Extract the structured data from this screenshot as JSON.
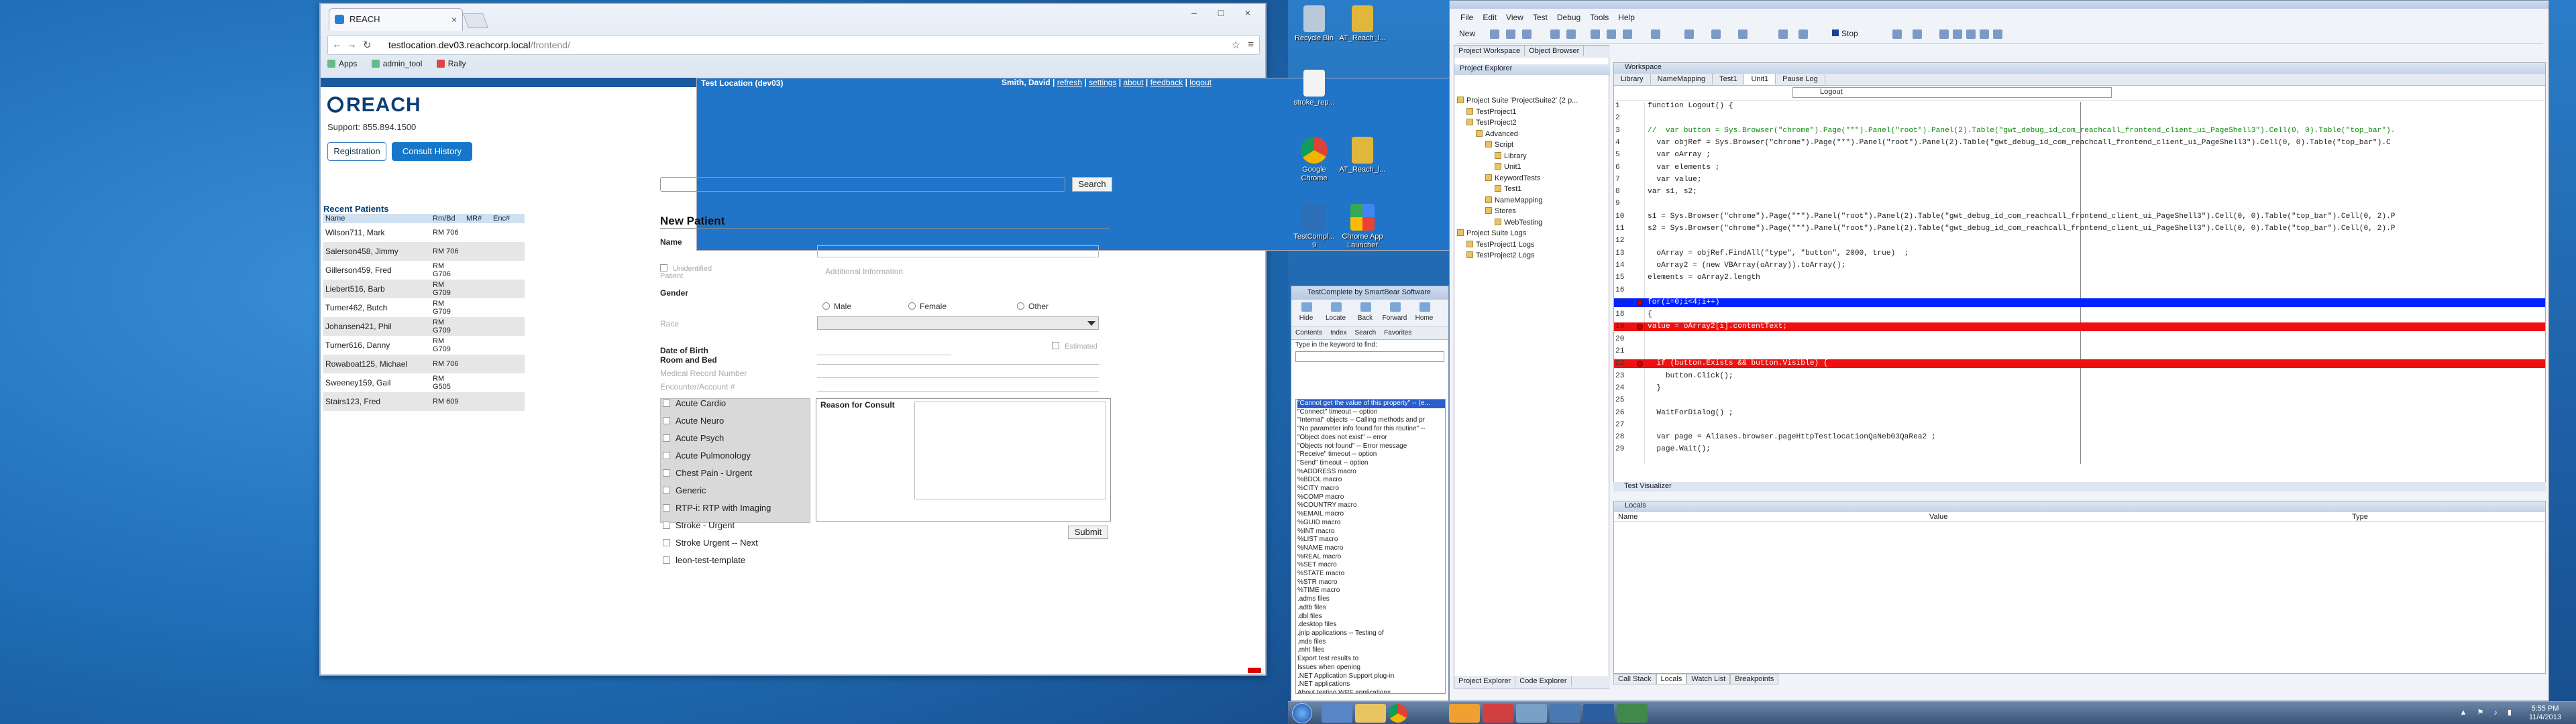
{
  "browser": {
    "tab_title": "REACH",
    "url_domain": "testlocation.dev03.reachcorp.local",
    "url_path": "/frontend/",
    "bookmarks": [
      "Apps",
      "admin_tool",
      "Rally"
    ]
  },
  "app": {
    "location_badge": "Test Location (dev03)",
    "user_name": "Smith, David",
    "nav_links": [
      "refresh",
      "settings",
      "about",
      "feedback",
      "logout"
    ],
    "logo_text": "REACH",
    "support": "Support: 855.894.1500",
    "btn_registration": "Registration",
    "btn_consult_history": "Consult History",
    "search_button": "Search",
    "recent_title": "Recent Patients",
    "recent_headers": [
      "Name",
      "Rm/Bd",
      "MR#",
      "Enc#"
    ],
    "recent_patients": [
      {
        "name": "Wilson711, Mark",
        "rb": "RM 706"
      },
      {
        "name": "Salerson458, Jimmy",
        "rb": "RM 706"
      },
      {
        "name": "Gillerson459, Fred",
        "rb": "RM G706"
      },
      {
        "name": "Liebert516, Barb",
        "rb": "RM G709"
      },
      {
        "name": "Turner462, Butch",
        "rb": "RM G709"
      },
      {
        "name": "Johansen421, Phil",
        "rb": "RM G709"
      },
      {
        "name": "Turner616, Danny",
        "rb": "RM G709"
      },
      {
        "name": "Rowaboat125, Michael",
        "rb": "RM 706"
      },
      {
        "name": "Sweeney159, Gail",
        "rb": "RM G505"
      },
      {
        "name": "Stairs123, Fred",
        "rb": "RM 609"
      }
    ],
    "new_patient_title": "New Patient",
    "name_label": "Name",
    "unidentified_label": "Unidentified Patient",
    "additional_info": "Additional Information",
    "gender_label": "Gender",
    "gender_options": [
      "Male",
      "Female",
      "Other"
    ],
    "race_label": "Race",
    "dob_label": "Date of Birth",
    "estimated_label": "Estimated",
    "room_label": "Room and Bed",
    "mrn_label": "Medical Record Number",
    "enc_label": "Encounter/Account #",
    "reason_label": "Reason for Consult",
    "submit_label": "Submit",
    "consult_types": [
      "Acute Cardio",
      "Acute Neuro",
      "Acute Psych",
      "Acute Pulmonology",
      "Chest Pain - Urgent",
      "Generic",
      "RTP-i: RTP with Imaging",
      "Stroke - Urgent",
      "Stroke Urgent -- Next",
      "leon-test-template"
    ]
  },
  "desktop_icons": [
    {
      "label": "Recycle Bin",
      "color": "#b9c9d9"
    },
    {
      "label": "AT_Reach_l...",
      "color": "#e0b73a"
    },
    {
      "label": "stroke_rep...",
      "color": "#f3f3f3"
    },
    {
      "label": "Google Chrome",
      "color": "#3a9b48"
    },
    {
      "label": "AT_Reach_l...",
      "color": "#e0b73a"
    },
    {
      "label": "TestCompl... 9",
      "color": "#2a6fb8"
    },
    {
      "label": "Chrome App Launcher",
      "color": "#4a90e2"
    }
  ],
  "help_window": {
    "title": "TestComplete by SmartBear Software",
    "tools": [
      "Hide",
      "Locate",
      "Back",
      "Forward",
      "Home"
    ],
    "tabs": [
      "Contents",
      "Index",
      "Search",
      "Favorites"
    ],
    "keyword_prompt": "Type in the keyword to find:",
    "selected": "\"Cannot get the value of this property\" -- (e...",
    "items": [
      "\"Connect\" timeout -- option",
      "\"Internal\" objects -- Calling methods and pr",
      "\"No parameter info found for this routine\" --",
      "\"Object does not exist\" -- error",
      "\"Objects not found\" -- Error message",
      "\"Receive\" timeout -- option",
      "\"Send\" timeout -- option",
      "%ADDRESS macro",
      "%BDOL macro",
      "%CITY macro",
      "%COMP macro",
      "%COUNTRY macro",
      "%EMAIL macro",
      "%GUID macro",
      "%INT macro",
      "%LIST macro",
      "%NAME macro",
      "%REAL macro",
      "%SET macro",
      "%STATE macro",
      "%STR macro",
      "%TIME macro",
      ".adms files",
      ".adtb files",
      ".dbl files",
      ".desktop files",
      ".jnlp applications -- Testing of",
      ".mds files",
      ".mht files",
      "  Export test results to",
      "  Issues when opening",
      ".NET Application Support plug-in",
      ".NET applications",
      "  About testing WPF applications"
    ]
  },
  "testcomplete": {
    "menu": [
      "File",
      "Edit",
      "View",
      "Test",
      "Debug",
      "Tools",
      "Help"
    ],
    "toolbar_new": "New",
    "toolbar_stop": "Stop",
    "explorer_tabs": [
      "Project Workspace",
      "Object Browser"
    ],
    "explorer_caption": "Project Explorer",
    "tree": [
      {
        "text": "Project Suite 'ProjectSuite2' (2 p...",
        "level": 0
      },
      {
        "text": "TestProject1",
        "level": 1
      },
      {
        "text": "TestProject2",
        "level": 1
      },
      {
        "text": "Advanced",
        "level": 2
      },
      {
        "text": "Script",
        "level": 3
      },
      {
        "text": "Library",
        "level": 4
      },
      {
        "text": "Unit1",
        "level": 4
      },
      {
        "text": "KeywordTests",
        "level": 3
      },
      {
        "text": "Test1",
        "level": 4
      },
      {
        "text": "NameMapping",
        "level": 3
      },
      {
        "text": "Stores",
        "level": 3
      },
      {
        "text": "WebTesting",
        "level": 4
      },
      {
        "text": "Project Suite Logs",
        "level": 0
      },
      {
        "text": "TestProject1 Logs",
        "level": 1
      },
      {
        "text": "TestProject2 Logs",
        "level": 1
      }
    ],
    "explorer_bottom_tabs": [
      "Project Explorer",
      "Code Explorer"
    ],
    "workspace_caption": "Workspace",
    "workspace_tabs": [
      "Library",
      "NameMapping",
      "Test1",
      "Unit1",
      "Pause Log"
    ],
    "routine": "Logout",
    "code_lines": [
      {
        "n": "1",
        "text": "function Logout() {",
        "style": ""
      },
      {
        "n": "2",
        "text": "",
        "style": ""
      },
      {
        "n": "3",
        "text": "//  var button = Sys.Browser(\"chrome\").Page(\"*\").Panel(\"root\").Panel(2).Table(\"gwt_debug_id_com_reachcall_frontend_client_ui_PageShell3\").Cell(0, 0).Table(\"top_bar\").",
        "style": "comment"
      },
      {
        "n": "4",
        "text": "  var objRef = Sys.Browser(\"chrome\").Page(\"*\").Panel(\"root\").Panel(2).Table(\"gwt_debug_id_com_reachcall_frontend_client_ui_PageShell3\").Cell(0, 0).Table(\"top_bar\").C",
        "style": ""
      },
      {
        "n": "5",
        "text": "  var oArray ;",
        "style": ""
      },
      {
        "n": "6",
        "text": "  var elements ;",
        "style": ""
      },
      {
        "n": "7",
        "text": "  var value;",
        "style": ""
      },
      {
        "n": "8",
        "text": "var s1, s2;",
        "style": ""
      },
      {
        "n": "9",
        "text": "",
        "style": ""
      },
      {
        "n": "10",
        "text": "s1 = Sys.Browser(\"chrome\").Page(\"*\").Panel(\"root\").Panel(2).Table(\"gwt_debug_id_com_reachcall_frontend_client_ui_PageShell3\").Cell(0, 0).Table(\"top_bar\").Cell(0, 2).P",
        "style": ""
      },
      {
        "n": "11",
        "text": "s2 = Sys.Browser(\"chrome\").Page(\"*\").Panel(\"root\").Panel(2).Table(\"gwt_debug_id_com_reachcall_frontend_client_ui_PageShell3\").Cell(0, 0).Table(\"top_bar\").Cell(0, 2).P",
        "style": ""
      },
      {
        "n": "12",
        "text": "",
        "style": ""
      },
      {
        "n": "13",
        "text": "  oArray = objRef.FindAll(\"type\", \"button\", 2000, true)  ;",
        "style": ""
      },
      {
        "n": "14",
        "text": "  oArray2 = (new VBArray(oArray)).toArray();",
        "style": ""
      },
      {
        "n": "15",
        "text": "elements = oArray2.length",
        "style": ""
      },
      {
        "n": "16",
        "text": "",
        "style": ""
      },
      {
        "n": "17",
        "text": "for(i=0;i<4;i++)",
        "style": "blue"
      },
      {
        "n": "18",
        "text": "{",
        "style": ""
      },
      {
        "n": "19",
        "text": "value = oArray2[i].contentText;",
        "style": "red"
      },
      {
        "n": "20",
        "text": "",
        "style": ""
      },
      {
        "n": "21",
        "text": "",
        "style": ""
      },
      {
        "n": "22",
        "text": "  if (button.Exists && button.Visible) {",
        "style": "red"
      },
      {
        "n": "23",
        "text": "    button.Click();",
        "style": ""
      },
      {
        "n": "24",
        "text": "  }",
        "style": ""
      },
      {
        "n": "25",
        "text": "",
        "style": ""
      },
      {
        "n": "26",
        "text": "  WaitForDialog() ;",
        "style": ""
      },
      {
        "n": "27",
        "text": "",
        "style": ""
      },
      {
        "n": "28",
        "text": "  var page = Aliases.browser.pageHttpTestlocationQaNeb03QaRea2 ;",
        "style": ""
      },
      {
        "n": "29",
        "text": "  page.Wait();",
        "style": ""
      }
    ],
    "test_visualizer": "Test Visualizer",
    "locals_caption": "Locals",
    "locals_columns": [
      "Name",
      "Value",
      "Type"
    ],
    "bottom_tabs": [
      "Call Stack",
      "Locals",
      "Watch List",
      "Breakpoints"
    ]
  },
  "taskbar": {
    "clock_time": "5:55 PM",
    "clock_date": "11/4/2013"
  }
}
